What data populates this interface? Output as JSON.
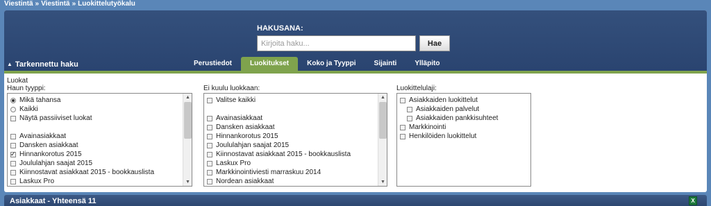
{
  "breadcrumb": [
    "Viestintä",
    "»",
    "Viestintä",
    "»",
    "Luokittelutyökalu"
  ],
  "search": {
    "label": "HAKUSANA:",
    "placeholder": "Kirjoita haku...",
    "button": "Hae"
  },
  "advanced_toggle": "Tarkennettu haku",
  "tabs": [
    {
      "label": "Perustiedot",
      "active": false
    },
    {
      "label": "Luokitukset",
      "active": true
    },
    {
      "label": "Koko ja Tyyppi",
      "active": false
    },
    {
      "label": "Sijainti",
      "active": false
    },
    {
      "label": "Ylläpito",
      "active": false
    }
  ],
  "section_title": "Luokat",
  "col1": {
    "label": "Haun tyyppi:",
    "radios": [
      {
        "label": "Mikä tahansa",
        "checked": true
      },
      {
        "label": "Kaikki",
        "checked": false
      }
    ],
    "passive": "Näytä passiiviset luokat",
    "items": [
      {
        "label": "Avainasiakkaat",
        "checked": false
      },
      {
        "label": "Dansken asiakkaat",
        "checked": false
      },
      {
        "label": "Hinnankorotus 2015",
        "checked": true
      },
      {
        "label": "Joululahjan saajat 2015",
        "checked": false
      },
      {
        "label": "Kiinnostavat asiakkaat 2015 - bookkauslista",
        "checked": false
      },
      {
        "label": "Laskux Pro",
        "checked": false
      }
    ]
  },
  "col2": {
    "label": "Ei kuulu luokkaan:",
    "select_all": "Valitse kaikki",
    "items": [
      {
        "label": "Avainasiakkaat"
      },
      {
        "label": "Dansken asiakkaat"
      },
      {
        "label": "Hinnankorotus 2015"
      },
      {
        "label": "Joululahjan saajat 2015"
      },
      {
        "label": "Kiinnostavat asiakkaat 2015 - bookkauslista"
      },
      {
        "label": "Laskux Pro"
      },
      {
        "label": "Markkinointiviesti marraskuu 2014"
      },
      {
        "label": "Nordean asiakkaat"
      }
    ]
  },
  "col3": {
    "label": "Luokittelulaji:",
    "items": [
      {
        "label": "Asiakkaiden luokittelut",
        "indent": false
      },
      {
        "label": "Asiakkaiden palvelut",
        "indent": true
      },
      {
        "label": "Asiakkaiden pankkisuhteet",
        "indent": true
      },
      {
        "label": "Markkinointi",
        "indent": false
      },
      {
        "label": "Henkilöiden luokittelut",
        "indent": false
      }
    ]
  },
  "footer": {
    "title": "Asiakkaat - Yhteensä 11",
    "export_icon": "excel-icon"
  }
}
